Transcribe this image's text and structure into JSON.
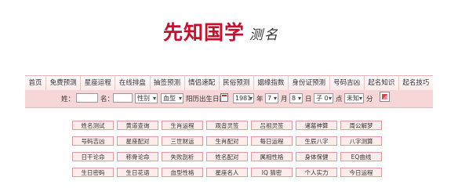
{
  "logo": {
    "main": "先知国学",
    "side": "测名"
  },
  "nav": {
    "items": [
      "首页",
      "免费预测",
      "星座运程",
      "在线排盘",
      "抽签预测",
      "情侣速配",
      "民俗预测",
      "姻缘指数",
      "身份证预测",
      "号码吉凶",
      "起名知识",
      "起名技巧"
    ]
  },
  "form": {
    "surname_label": "姓：",
    "surname_value": "",
    "name_label": "名：",
    "name_value": "",
    "gender_value": "性别",
    "blood_value": "血型",
    "date_label": "阳历出生日期:",
    "year_value": "1981",
    "year_unit": "年",
    "month_value": "7",
    "month_unit": "月",
    "day_value": "8",
    "day_unit": "日",
    "hour_value": "子 0",
    "hour_unit": "点",
    "minute_value": "未知",
    "minute_unit": "分"
  },
  "links": [
    [
      "姓名测试",
      "黄道查询",
      "生肖运程",
      "观音灵签",
      "吕祖灵签",
      "诸葛神算",
      "周公解梦"
    ],
    [
      "号码吉凶",
      "星座配对",
      "三世财运",
      "生肖配对",
      "每日运程",
      "生辰八字",
      "八字测算"
    ],
    [
      "日干论命",
      "称骨论命",
      "失败剖析",
      "姓名配对",
      "属相性格",
      "身体保健",
      "EQ曲线"
    ],
    [
      "生日密码",
      "生日花语",
      "血型性格",
      "星座名人",
      "IQ 猜密",
      "个人实力",
      "今日运程"
    ]
  ]
}
